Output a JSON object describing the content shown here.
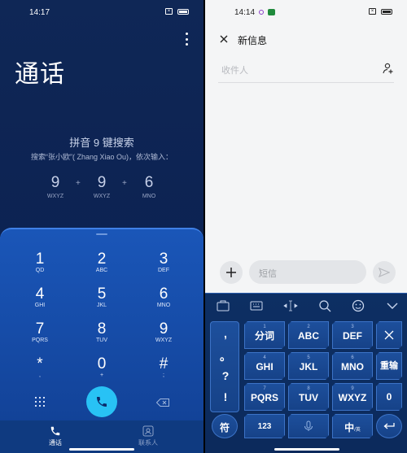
{
  "left": {
    "status": {
      "time": "14:17"
    },
    "title": "通话",
    "hint_title": "拼音 9 键搜索",
    "hint_sub": "搜索“张小欧”( Zhang Xiao Ou)，依次输入：",
    "sequence": [
      {
        "num": "9",
        "letters": "WXYZ"
      },
      {
        "num": "9",
        "letters": "WXYZ"
      },
      {
        "num": "6",
        "letters": "MNO"
      }
    ],
    "plus": "+",
    "keys": [
      {
        "num": "1",
        "letters": "QD"
      },
      {
        "num": "2",
        "letters": "ABC"
      },
      {
        "num": "3",
        "letters": "DEF"
      },
      {
        "num": "4",
        "letters": "GHI"
      },
      {
        "num": "5",
        "letters": "JKL"
      },
      {
        "num": "6",
        "letters": "MNO"
      },
      {
        "num": "7",
        "letters": "PQRS"
      },
      {
        "num": "8",
        "letters": "TUV"
      },
      {
        "num": "9",
        "letters": "WXYZ"
      },
      {
        "num": "*",
        "letters": ","
      },
      {
        "num": "0",
        "letters": "+"
      },
      {
        "num": "#",
        "letters": ";"
      }
    ],
    "nav": {
      "calls": "通话",
      "contacts": "联系人"
    }
  },
  "right": {
    "status": {
      "time": "14:14"
    },
    "title": "新信息",
    "recipient_placeholder": "收件人",
    "message_placeholder": "短信",
    "punct": [
      ",",
      "。",
      "?",
      "!"
    ],
    "keys_row1": [
      {
        "num": "1",
        "label": "分词"
      },
      {
        "num": "2",
        "label": "ABC"
      },
      {
        "num": "3",
        "label": "DEF"
      }
    ],
    "keys_row2": [
      {
        "num": "4",
        "label": "GHI"
      },
      {
        "num": "5",
        "label": "JKL"
      },
      {
        "num": "6",
        "label": "MNO"
      }
    ],
    "keys_row3": [
      {
        "num": "7",
        "label": "PQRS"
      },
      {
        "num": "8",
        "label": "TUV"
      },
      {
        "num": "9",
        "label": "WXYZ"
      }
    ],
    "reinput": "重输",
    "zero": "0",
    "symbols": "符",
    "num_key": "123",
    "lang_main": "中",
    "lang_sub": "/英"
  },
  "colors": {
    "accent": "#28c2f5",
    "pad": "#1a56b8",
    "keyboard": "#0d2f63"
  }
}
